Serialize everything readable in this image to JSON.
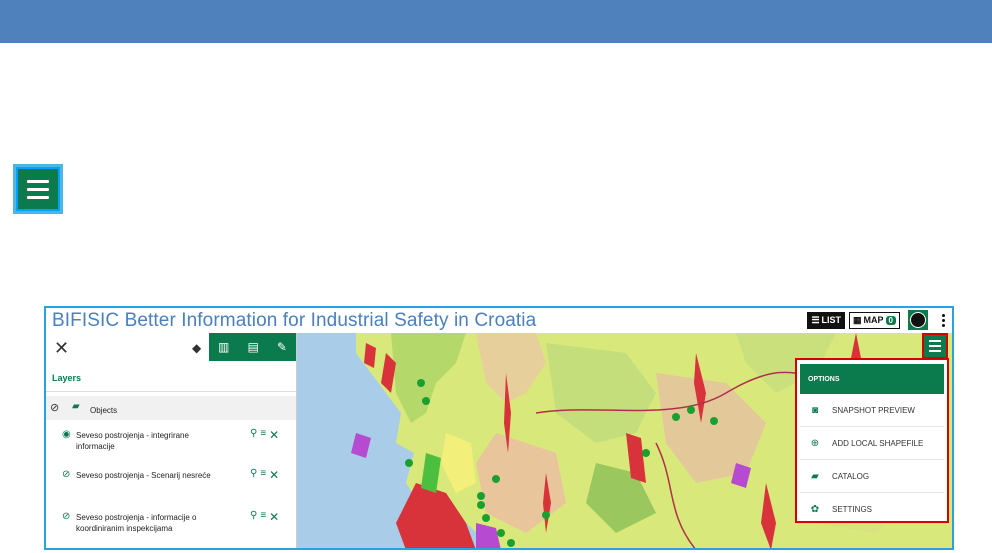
{
  "app": {
    "title": "BIFISIC Better Information for Industrial Safety in Croatia"
  },
  "top_controls": {
    "list_label": "LIST",
    "map_label": "MAP",
    "map_count": "0"
  },
  "side_panel": {
    "layers_title": "Layers",
    "group_label": "Objects",
    "layers": [
      {
        "label": "Seveso postrojenja - integrirane informacije"
      },
      {
        "label": "Seveso postrojenja - Scenarij nesreće"
      },
      {
        "label": "Seveso postrojenja - informacije o koordiniranim inspekcijama"
      }
    ]
  },
  "options_menu": {
    "header": "OPTIONS",
    "items": [
      {
        "label": "SNAPSHOT PREVIEW",
        "icon": "camera-icon"
      },
      {
        "label": "ADD LOCAL SHAPEFILE",
        "icon": "upload-icon"
      },
      {
        "label": "CATALOG",
        "icon": "folder-icon"
      },
      {
        "label": "SETTINGS",
        "icon": "gear-icon"
      }
    ]
  },
  "colors": {
    "topbar": "#4f81bd",
    "accent_green": "#0b7a4d",
    "highlight_red": "#d40000",
    "highlight_blue": "#29a3e0"
  }
}
